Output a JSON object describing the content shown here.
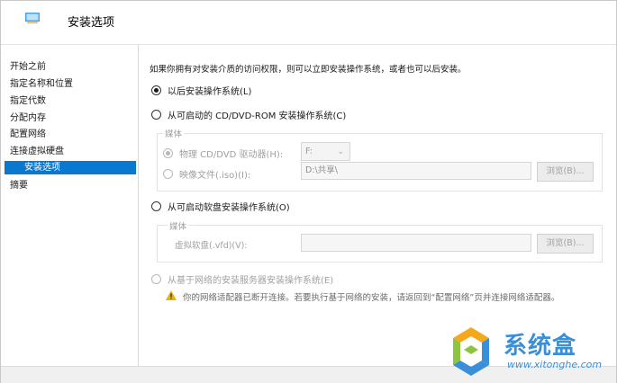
{
  "header": {
    "title": "安装选项",
    "icon": "hyperv-wizard-icon"
  },
  "sidebar": {
    "items": [
      {
        "label": "开始之前",
        "selected": false
      },
      {
        "label": "指定名称和位置",
        "selected": false
      },
      {
        "label": "指定代数",
        "selected": false
      },
      {
        "label": "分配内存",
        "selected": false
      },
      {
        "label": "配置网络",
        "selected": false
      },
      {
        "label": "连接虚拟硬盘",
        "selected": false
      },
      {
        "label": "安装选项",
        "selected": true
      },
      {
        "label": "摘要",
        "selected": false
      }
    ]
  },
  "content": {
    "intro": "如果你拥有对安装介质的访问权限，则可以立即安装操作系统，或者也可以后安装。",
    "options": {
      "later": {
        "label": "以后安装操作系统(L)",
        "checked": true,
        "disabled": false
      },
      "cd": {
        "label": "从可启动的 CD/DVD-ROM 安装操作系统(C)",
        "checked": false,
        "disabled": false,
        "group_label": "媒体",
        "physical_label": "物理 CD/DVD 驱动器(H):",
        "physical_value": "F:",
        "iso_label": "映像文件(.iso)(I):",
        "iso_value": "D:\\共享\\",
        "browse_label": "浏览(B)..."
      },
      "floppy": {
        "label": "从可启动软盘安装操作系统(O)",
        "checked": false,
        "disabled": false,
        "group_label": "媒体",
        "vfd_label": "虚拟软盘(.vfd)(V):",
        "vfd_value": "",
        "browse_label": "浏览(B)..."
      },
      "network": {
        "label": "从基于网络的安装服务器安装操作系统(E)",
        "checked": false,
        "disabled": true
      }
    },
    "warning": "你的网络适配器已断开连接。若要执行基于网络的安装，请返回到“配置网络”页并连接网络适配器。"
  },
  "watermark": {
    "name": "系统盒",
    "url": "www.xitonghe.com"
  },
  "colors": {
    "accent": "#0b78d0",
    "disabled_text": "#a0a0a0",
    "warning": "#e8b400",
    "watermark": "#3a8fd8"
  }
}
